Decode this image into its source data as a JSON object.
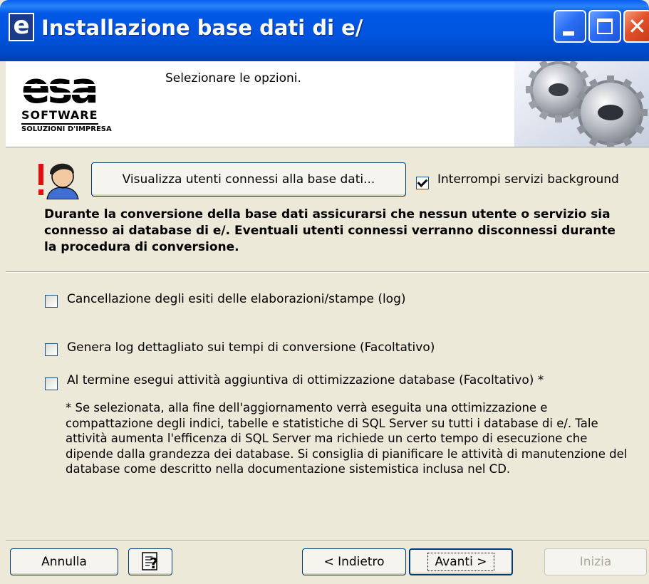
{
  "window": {
    "title": "Installazione base dati di e/",
    "app_icon": "e",
    "controls": [
      "minimize-icon",
      "maximize-icon",
      "close-icon"
    ]
  },
  "header": {
    "logo_text": "esa",
    "logo_software": "SOFTWARE",
    "logo_tagline": "SOLUZIONI D'IMPRESA",
    "subtitle": "Selezionare le opzioni."
  },
  "connection": {
    "view_users_button": "Visualizza utenti connessi alla base dati...",
    "background_services_label": "Interrompi servizi background",
    "background_services_checked": true,
    "warning_text": "Durante la conversione della base dati assicurarsi che nessun utente o servizio sia connesso ai database di e/. Eventuali utenti connessi verranno disconnessi durante la procedura di conversione."
  },
  "options": [
    {
      "label": "Cancellazione degli esiti delle elaborazioni/stampe (log)",
      "checked": false
    },
    {
      "label": "Genera log dettagliato sui tempi di conversione (Facoltativo)",
      "checked": false
    },
    {
      "label": "Al termine esegui attività aggiuntiva di ottimizzazione database (Facoltativo) *",
      "checked": false
    }
  ],
  "note": "* Se selezionata, alla fine dell'aggiornamento verrà eseguita una ottimizzazione e compattazione degli indici, tabelle e statistiche di SQL Server su tutti i database di e/. Tale attività aumenta l'efficenza di SQL Server ma richiede un certo tempo di esecuzione che dipende dalla grandezza dei database. Si consiglia di pianificare le attività di manutenzione del database come descritto nella documentazione sistemistica inclusa nel CD.",
  "footer": {
    "cancel": "Annulla",
    "help_icon": "help-icon",
    "back": "< Indietro",
    "next": "Avanti >",
    "start": "Inizia",
    "start_enabled": false
  },
  "colors": {
    "titlebar": "#0053dd",
    "dialog_bg": "#ece9d8",
    "button_border": "#003c74",
    "disabled_text": "#aca899",
    "warning_red": "#e01010"
  }
}
